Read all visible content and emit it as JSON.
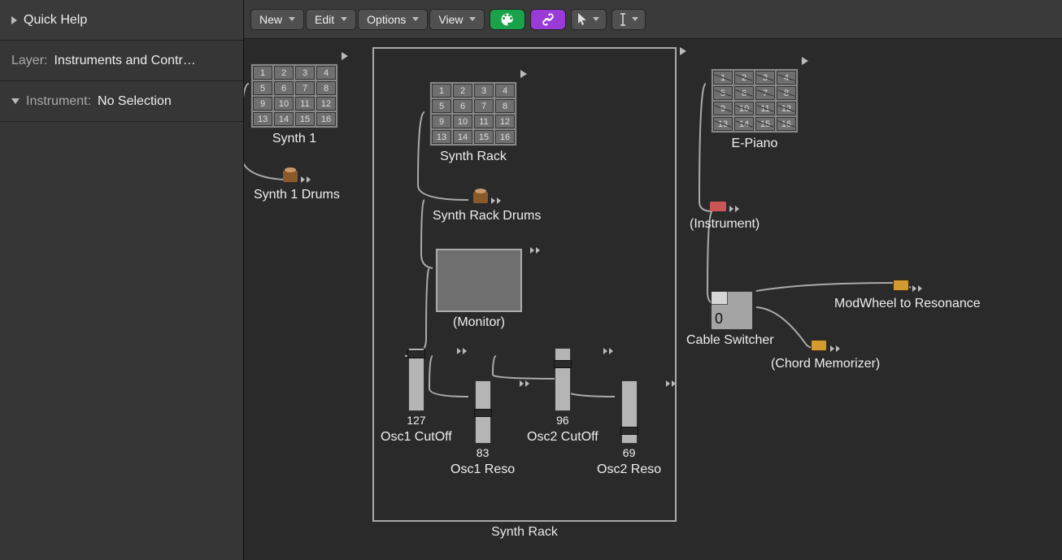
{
  "sidebar": {
    "quickhelp_title": "Quick Help",
    "layer_label": "Layer:",
    "layer_value": "Instruments and Contr…",
    "instrument_label": "Instrument:",
    "instrument_value": "No Selection"
  },
  "toolbar": {
    "new": "New",
    "edit": "Edit",
    "options": "Options",
    "view": "View"
  },
  "frame": {
    "title": "Synth Rack"
  },
  "nodes": {
    "synth1": {
      "label": "Synth 1"
    },
    "synth1_drums": {
      "label": "Synth 1 Drums"
    },
    "synth_rack": {
      "label": "Synth Rack"
    },
    "synth_rack_drums": {
      "label": "Synth Rack Drums"
    },
    "monitor": {
      "label": "(Monitor)"
    },
    "osc1_cutoff": {
      "label": "Osc1 CutOff",
      "value": "127"
    },
    "osc1_reso": {
      "label": "Osc1 Reso",
      "value": "83"
    },
    "osc2_cutoff": {
      "label": "Osc2 CutOff",
      "value": "96"
    },
    "osc2_reso": {
      "label": "Osc2 Reso",
      "value": "69"
    },
    "epiano": {
      "label": "E-Piano"
    },
    "instrument_placeholder": {
      "label": "(Instrument)"
    },
    "cable_switcher": {
      "label": "Cable Switcher",
      "value": "0"
    },
    "modwheel": {
      "label": "ModWheel to Resonance"
    },
    "chord_memorizer": {
      "label": "(Chord Memorizer)"
    }
  },
  "keypad_cells": [
    "1",
    "2",
    "3",
    "4",
    "5",
    "6",
    "7",
    "8",
    "9",
    "10",
    "11",
    "12",
    "13",
    "14",
    "15",
    "16"
  ]
}
